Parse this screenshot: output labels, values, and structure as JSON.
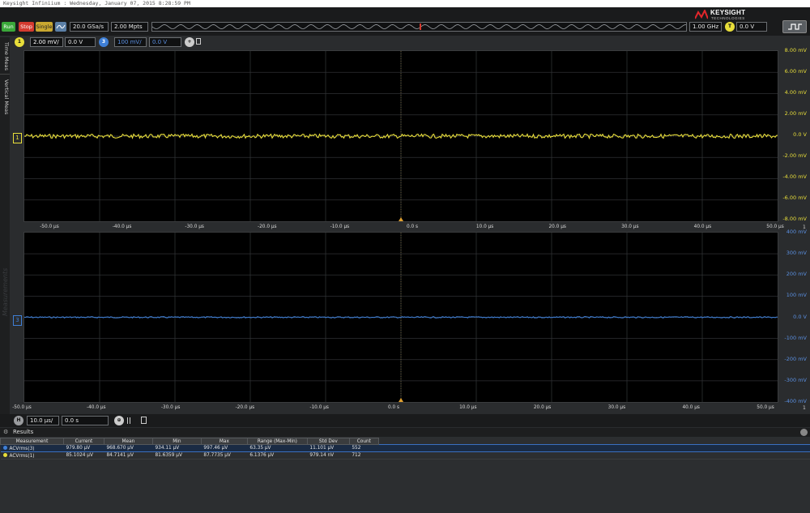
{
  "window": {
    "title": "Keysight Infiniium : Wednesday, January 07, 2015 8:28:59 PM"
  },
  "brand": {
    "name": "KEYSIGHT",
    "sub": "TECHNOLOGIES"
  },
  "colors": {
    "ch1": "#e8de3a",
    "ch3": "#3f7fd6",
    "run": "#3aa83a",
    "stop": "#d43a2f",
    "single": "#c9a830"
  },
  "toolbar": {
    "run": "Run",
    "stop": "Stop",
    "single": "Single",
    "sample_rate": "20.0 GSa/s",
    "memory": "2.00 Mpts",
    "bandwidth": "1.00 GHz",
    "trigger_badge": "T",
    "trigger_level": "0.0 V"
  },
  "channels": {
    "ch1": {
      "badge": "1",
      "scale": "2.00 mV/",
      "offset": "0.0 V"
    },
    "ch3": {
      "badge": "3",
      "scale": "100 mV/",
      "offset": "0.0 V"
    },
    "add": "+"
  },
  "sidebar": {
    "tabs": [
      "Time Meas",
      "Vertical Meas"
    ],
    "watermark": "Measurements"
  },
  "upper_grid": {
    "marker": "1",
    "y_labels": [
      "8.00 mV",
      "6.00 mV",
      "4.00 mV",
      "2.00 mV",
      "0.0 V",
      "-2.00 mV",
      "-4.00 mV",
      "-6.00 mV",
      "-8.00 mV"
    ],
    "x_labels": [
      "-50.0 µs",
      "-40.0 µs",
      "-30.0 µs",
      "-20.0 µs",
      "-10.0 µs",
      "0.0 s",
      "10.0 µs",
      "20.0 µs",
      "30.0 µs",
      "40.0 µs",
      "50.0 µs"
    ],
    "corner": "1"
  },
  "lower_grid": {
    "marker": "3",
    "y_labels": [
      "400 mV",
      "300 mV",
      "200 mV",
      "100 mV",
      "0.0 V",
      "-100 mV",
      "-200 mV",
      "-300 mV",
      "-400 mV"
    ],
    "x_labels": [
      "-50.0 µs",
      "-40.0 µs",
      "-30.0 µs",
      "-20.0 µs",
      "-10.0 µs",
      "0.0 s",
      "10.0 µs",
      "20.0 µs",
      "30.0 µs",
      "40.0 µs",
      "50.0 µs"
    ],
    "corner": "1"
  },
  "timebase": {
    "badge": "H",
    "scale": "10.0 µs/",
    "position": "0.0 s"
  },
  "results": {
    "title": "Results",
    "columns": [
      "Measurement",
      "Current",
      "Mean",
      "Min",
      "Max",
      "Range (Max-Min)",
      "Std Dev",
      "Count"
    ],
    "rows": [
      [
        "ACVrms(3)",
        "979.80 µV",
        "968.670 µV",
        "934.11 µV",
        "997.46 µV",
        "63.35 µV",
        "11.101 µV",
        "552"
      ],
      [
        "ACVrms(1)",
        "85.1024 µV",
        "84.7141 µV",
        "81.6359 µV",
        "87.7735 µV",
        "6.1376 µV",
        "979.14 nV",
        "712"
      ]
    ]
  }
}
